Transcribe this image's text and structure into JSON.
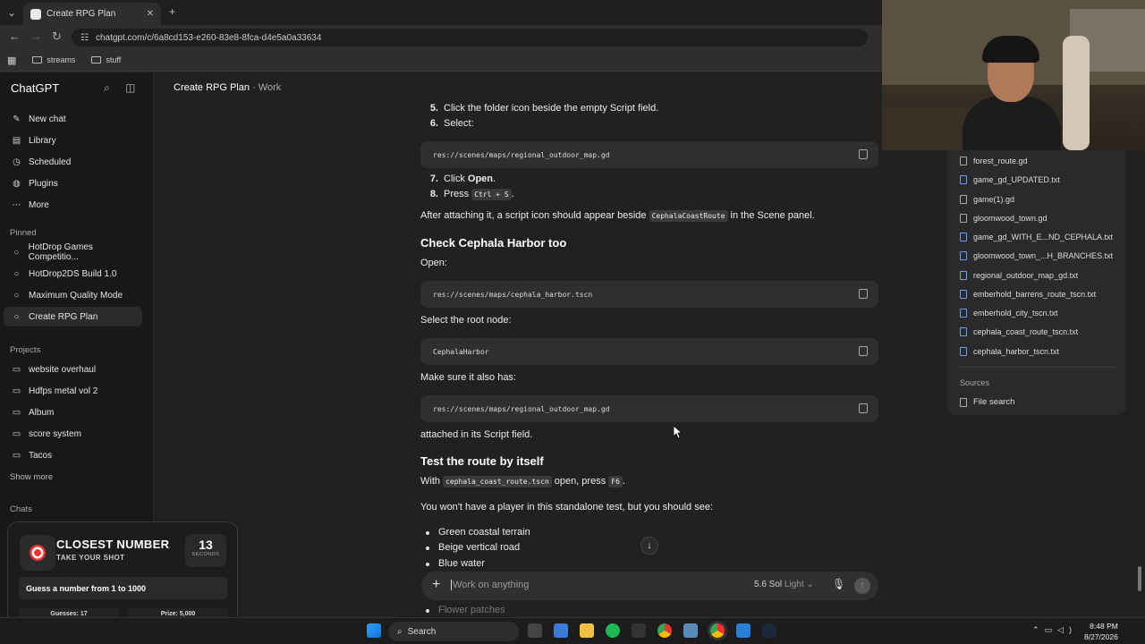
{
  "browser": {
    "tab_title": "Create RPG Plan",
    "url": "chatgpt.com/c/6a8cd153-e260-83e8-8fca-d4e5a0a33634",
    "bookmarks": [
      "streams",
      "stuff"
    ]
  },
  "sidebar": {
    "brand": "ChatGPT",
    "nav": [
      {
        "label": "New chat",
        "icon": "edit-icon"
      },
      {
        "label": "Library",
        "icon": "library-icon"
      },
      {
        "label": "Scheduled",
        "icon": "clock-icon"
      },
      {
        "label": "Plugins",
        "icon": "plugin-icon"
      },
      {
        "label": "More",
        "icon": "more-icon"
      }
    ],
    "pinned_header": "Pinned",
    "pinned": [
      "HotDrop Games Competitio...",
      "HotDrop2DS Build 1.0",
      "Maximum Quality Mode",
      "Create RPG Plan"
    ],
    "projects_header": "Projects",
    "projects": [
      "website overhaul",
      "Hdfps metal vol 2",
      "Album",
      "score system",
      "Tacos"
    ],
    "show_more": "Show more",
    "chats_header": "Chats"
  },
  "widget": {
    "title": "CLOSEST NUMBER",
    "subtitle": "TAKE YOUR SHOT",
    "timer_value": "13",
    "timer_label": "SECONDS",
    "prompt": "Guess a number from 1 to 1000",
    "guesses": "Guesses: 17",
    "prize": "Prize: 5,000",
    "progress_fraction": 0.22
  },
  "chat": {
    "title": "Create RPG Plan",
    "separator": "·",
    "workspace": "Work",
    "step5_num": "5.",
    "step5": "Click the folder icon beside the empty Script field.",
    "step6_num": "6.",
    "step6": "Select:",
    "code1": "res://scenes/maps/regional_outdoor_map.gd",
    "step7_num": "7.",
    "step7_pre": "Click ",
    "step7_bold": "Open",
    "step7_post": ".",
    "step8_num": "8.",
    "step8_pre": "Press ",
    "step8_code": "Ctrl + S",
    "step8_post": ".",
    "after_pre": "After attaching it, a script icon should appear beside ",
    "after_code": "CephalaCoastRoute",
    "after_post": " in the Scene panel.",
    "h_check": "Check Cephala Harbor too",
    "open_label": "Open:",
    "code2": "res://scenes/maps/cephala_harbor.tscn",
    "select_root": "Select the root node:",
    "code3": "CephalaHarbor",
    "make_sure": "Make sure it also has:",
    "code4": "res://scenes/maps/regional_outdoor_map.gd",
    "attached": "attached in its Script field.",
    "h_test": "Test the route by itself",
    "with_pre": "With ",
    "with_code": "cephala_coast_route.tscn",
    "with_mid": " open, press ",
    "with_key": "F6",
    "with_post": ".",
    "no_player": "You won't have a player in this standalone test, but you should see:",
    "bullets": [
      "Green coastal terrain",
      "Beige vertical road",
      "Blue water",
      "Flower patches"
    ]
  },
  "composer": {
    "placeholder": "Work on anything",
    "model": "5.6 Sol",
    "model_mode": "Light"
  },
  "files": {
    "items": [
      "forest_route.gd",
      "game_gd_UPDATED.txt",
      "game(1).gd",
      "gloomwood_town.gd",
      "game_gd_WITH_E...ND_CEPHALA.txt",
      "gloomwood_town_...H_BRANCHES.txt",
      "regional_outdoor_map_gd.txt",
      "emberhold_barrens_route_tscn.txt",
      "emberhold_city_tscn.txt",
      "cephala_coast_route_tscn.txt",
      "cephala_harbor_tscn.txt"
    ],
    "sources_header": "Sources",
    "file_search": "File search"
  },
  "taskbar": {
    "search": "Search",
    "time": "8:48 PM",
    "date": "8/27/2026"
  }
}
